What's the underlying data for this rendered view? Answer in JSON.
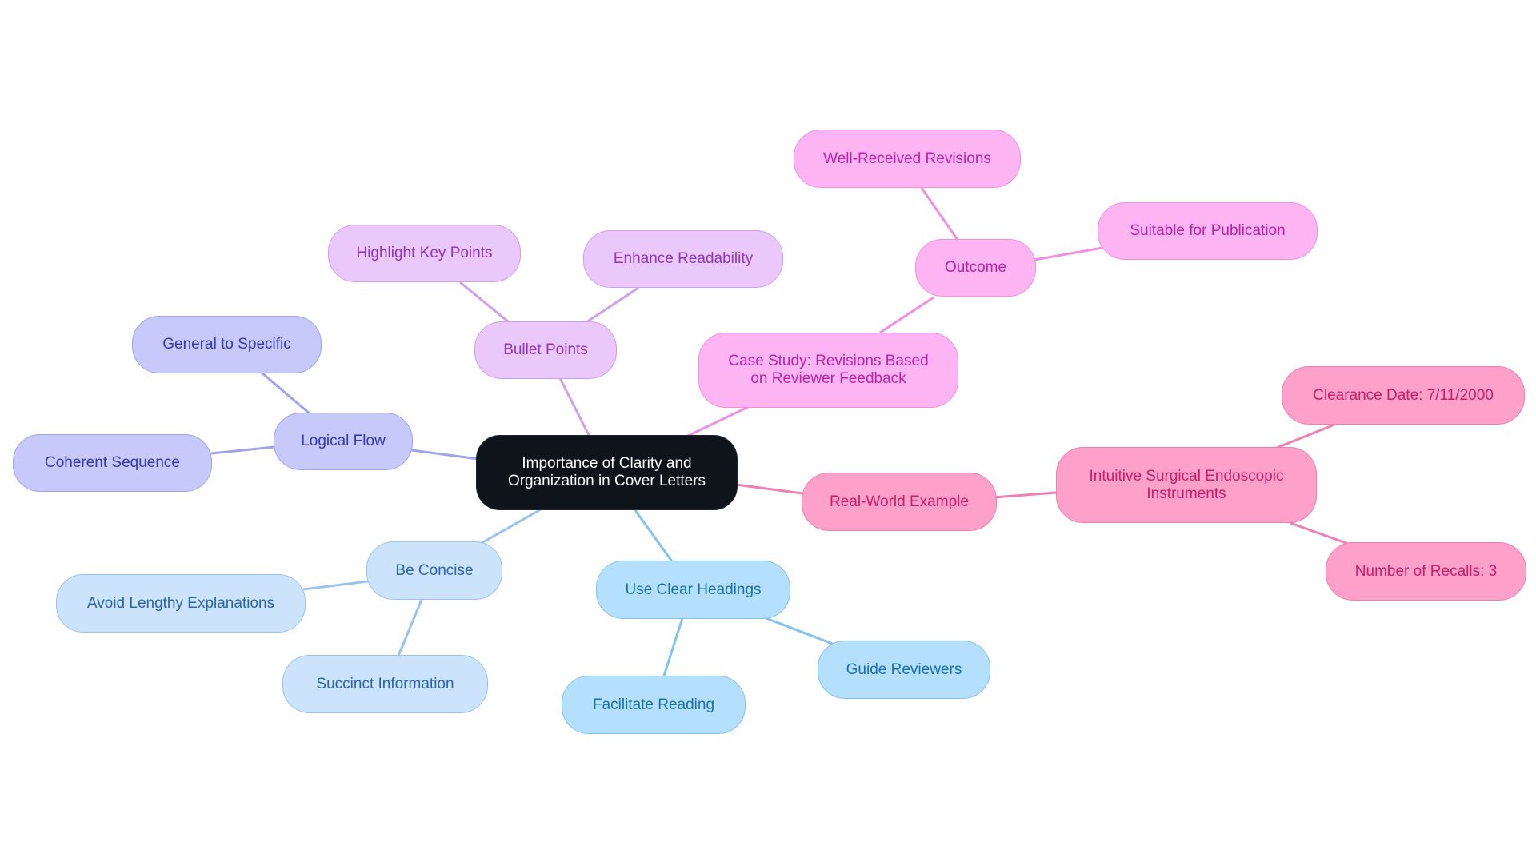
{
  "diagram": {
    "type": "mindmap",
    "root": {
      "id": "root",
      "label": "Importance of Clarity and Organization in Cover Letters"
    },
    "branches": [
      {
        "id": "logical-flow",
        "label": "Logical Flow",
        "color": "#9ea3ea",
        "children": [
          {
            "id": "general-to-specific",
            "label": "General to Specific"
          },
          {
            "id": "coherent-sequence",
            "label": "Coherent Sequence"
          }
        ]
      },
      {
        "id": "bullet-points",
        "label": "Bullet Points",
        "color": "#cf9eec",
        "children": [
          {
            "id": "highlight-key-points",
            "label": "Highlight Key Points"
          },
          {
            "id": "enhance-readability",
            "label": "Enhance Readability"
          }
        ]
      },
      {
        "id": "case-study",
        "label": "Case Study: Revisions Based on Reviewer Feedback",
        "color": "#ef8fe3",
        "children": [
          {
            "id": "outcome",
            "label": "Outcome",
            "children": [
              {
                "id": "well-received-revisions",
                "label": "Well-Received Revisions"
              },
              {
                "id": "suitable-for-publication",
                "label": "Suitable for Publication"
              }
            ]
          }
        ]
      },
      {
        "id": "real-world-example",
        "label": "Real-World Example",
        "color": "#ee7fb2",
        "children": [
          {
            "id": "intuitive-surgical",
            "label": "Intuitive Surgical Endoscopic Instruments",
            "children": [
              {
                "id": "clearance-date",
                "label": "Clearance Date: 7/11/2000"
              },
              {
                "id": "number-of-recalls",
                "label": "Number of Recalls: 3"
              }
            ]
          }
        ]
      },
      {
        "id": "use-clear-headings",
        "label": "Use Clear Headings",
        "color": "#82c2ef",
        "children": [
          {
            "id": "guide-reviewers",
            "label": "Guide Reviewers"
          },
          {
            "id": "facilitate-reading",
            "label": "Facilitate Reading"
          }
        ]
      },
      {
        "id": "be-concise",
        "label": "Be Concise",
        "color": "#99c3ee",
        "children": [
          {
            "id": "avoid-lengthy-explanations",
            "label": "Avoid Lengthy Explanations"
          },
          {
            "id": "succinct-information",
            "label": "Succinct Information"
          }
        ]
      }
    ]
  },
  "nodes": {
    "root_line1": "Importance of Clarity and",
    "root_line2": "Organization in Cover Letters",
    "logical_flow": "Logical Flow",
    "general_to_specific": "General to Specific",
    "coherent_sequence": "Coherent Sequence",
    "bullet_points": "Bullet Points",
    "highlight_key_points": "Highlight Key Points",
    "enhance_readability": "Enhance Readability",
    "case_study_line1": "Case Study: Revisions Based",
    "case_study_line2": "on Reviewer Feedback",
    "outcome": "Outcome",
    "well_received_revisions": "Well-Received Revisions",
    "suitable_for_publication": "Suitable for Publication",
    "real_world_example": "Real-World Example",
    "intuitive_line1": "Intuitive Surgical Endoscopic",
    "intuitive_line2": "Instruments",
    "clearance_date": "Clearance Date: 7/11/2000",
    "number_of_recalls": "Number of Recalls: 3",
    "use_clear_headings": "Use Clear Headings",
    "guide_reviewers": "Guide Reviewers",
    "facilitate_reading": "Facilitate Reading",
    "be_concise": "Be Concise",
    "avoid_lengthy_explanations": "Avoid Lengthy Explanations",
    "succinct_information": "Succinct Information"
  }
}
